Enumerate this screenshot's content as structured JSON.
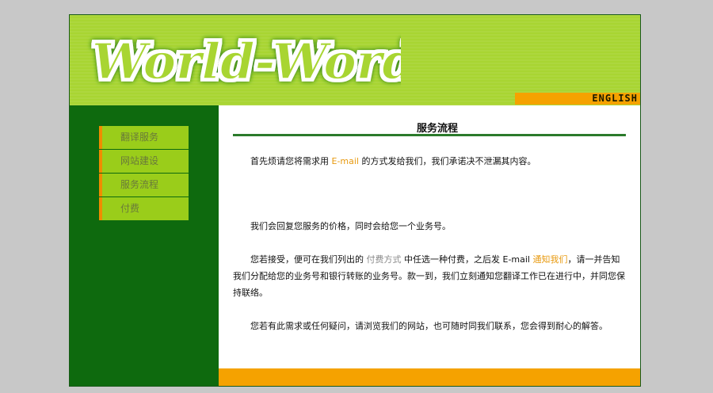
{
  "header": {
    "logo_text": "World-Word",
    "language_link": "ENGLISH"
  },
  "sidebar": {
    "items": [
      {
        "label": "翻译服务"
      },
      {
        "label": "网站建设"
      },
      {
        "label": "服务流程"
      },
      {
        "label": "付费"
      }
    ]
  },
  "content": {
    "title": "服务流程",
    "p1": {
      "before": "首先烦请您将需求用 ",
      "link": "E-mail",
      "after": " 的方式发给我们，我们承诺决不泄漏其内容。"
    },
    "p2": "我们会回复您服务的价格，同时会给您一个业务号。",
    "p3": {
      "before": "您若接受，便可在我们列出的 ",
      "link1": "付费方式",
      "middle": " 中任选一种付费，之后发 E-mail ",
      "link2": "通知我们",
      "after": "，请一并告知我们分配给您的业务号和银行转账的业务号。款一到，我们立刻通知您翻译工作已在进行中，并同您保持联络。"
    },
    "p4": "您若有此需求或任何疑问，请浏览我们的网站，也可随时同我们联系，您会得到耐心的解答。"
  },
  "colors": {
    "header_green": "#a8d532",
    "sidebar_green": "#0e6a0e",
    "menu_green": "#9acd1a",
    "accent_orange": "#f5a200",
    "link_orange": "#e89a10"
  }
}
